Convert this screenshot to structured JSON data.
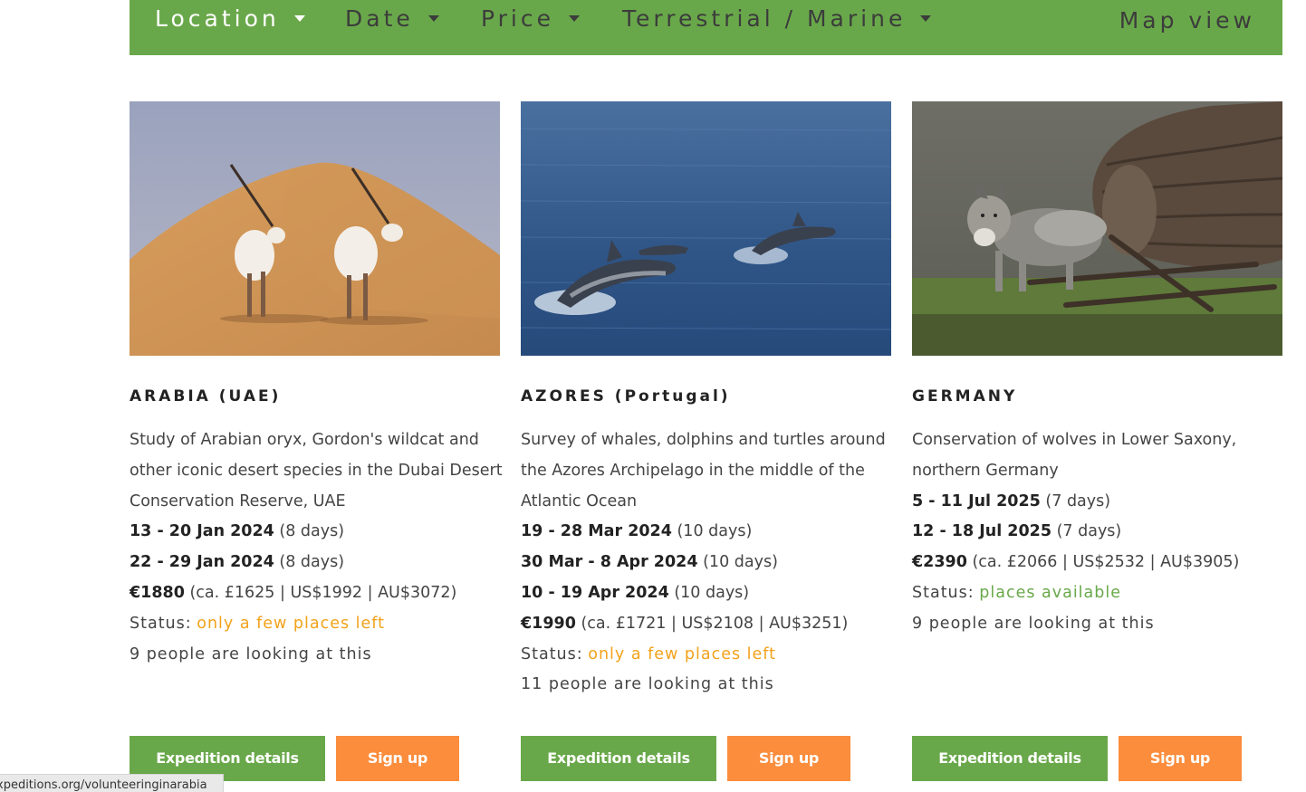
{
  "filters": {
    "location": "Location",
    "date": "Date",
    "price": "Price",
    "terrestrial_marine": "Terrestrial / Marine",
    "map_view": "Map view"
  },
  "colors": {
    "green": "#69a84a",
    "orange_button": "#fb8d3d",
    "orange_status": "#f2a21b"
  },
  "cards": [
    {
      "title": "ARABIA (UAE)",
      "desc": [
        "Study of Arabian oryx, Gordon's wildcat and",
        "other iconic desert species in the Dubai Desert",
        "Conservation Reserve, UAE"
      ],
      "dates": [
        {
          "range": "13 - 20 Jan 2024",
          "duration": "(8 days)"
        },
        {
          "range": "22 - 29 Jan 2024",
          "duration": "(8 days)"
        }
      ],
      "price": "€1880",
      "price_other": "(ca. £1625 | US$1992 | AU$3072)",
      "status_label": "Status:",
      "status": "only a few places left",
      "looking": "9 people are looking at this",
      "details_button": "Expedition details",
      "signup_button": "Sign up",
      "image_icon": "oryx-desert-photo"
    },
    {
      "title": "AZORES (Portugal)",
      "desc": [
        "Survey of whales, dolphins and turtles around",
        "the Azores Archipelago in the middle of the",
        "Atlantic Ocean"
      ],
      "dates": [
        {
          "range": "19 - 28 Mar 2024",
          "duration": "(10 days)"
        },
        {
          "range": "30 Mar - 8 Apr 2024",
          "duration": "(10 days)"
        },
        {
          "range": "10 - 19 Apr 2024",
          "duration": "(10 days)"
        }
      ],
      "price": "€1990",
      "price_other": "(ca. £1721 | US$2108 | AU$3251)",
      "status_label": "Status:",
      "status": "only a few places left",
      "looking": "11 people are looking at this",
      "details_button": "Expedition details",
      "signup_button": "Sign up",
      "image_icon": "dolphins-ocean-photo"
    },
    {
      "title": "GERMANY",
      "desc": [
        "Conservation of wolves in Lower Saxony,",
        "northern Germany"
      ],
      "dates": [
        {
          "range": "5 - 11 Jul 2025",
          "duration": "(7 days)"
        },
        {
          "range": "12 - 18 Jul 2025",
          "duration": "(7 days)"
        }
      ],
      "price": "€2390",
      "price_other": "(ca. £2066 | US$2532 | AU$3905)",
      "status_label": "Status:",
      "status": "places available",
      "looking": "9 people are looking at this",
      "details_button": "Expedition details",
      "signup_button": "Sign up",
      "image_icon": "wolf-forest-photo"
    }
  ],
  "status_url": "xpeditions.org/volunteeringinarabia"
}
